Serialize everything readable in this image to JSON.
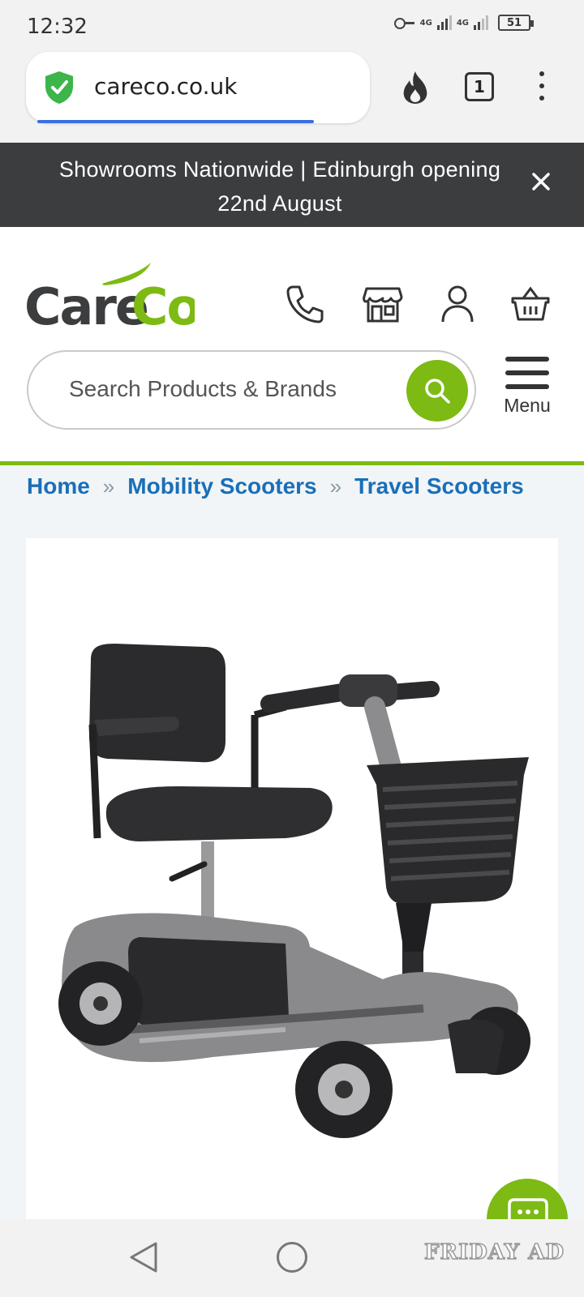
{
  "status_bar": {
    "time": "12:32",
    "network_1": "4G",
    "network_2": "4G",
    "battery": "51"
  },
  "browser": {
    "url": "careco.co.uk",
    "tab_count": "1",
    "page_load_progress": 0.86
  },
  "banner": {
    "text": "Showrooms Nationwide | Edinburgh opening 22nd August"
  },
  "header": {
    "logo_text": "CareCo",
    "search_placeholder": "Search Products & Brands",
    "menu_label": "Menu",
    "brand_green": "#7dba14",
    "brand_dark": "#3b3d3e"
  },
  "breadcrumb": [
    "Home",
    "Mobility Scooters",
    "Travel Scooters"
  ],
  "product": {
    "image_icon": "mobility-scooter-image"
  },
  "watermark": "FRIDAY AD"
}
